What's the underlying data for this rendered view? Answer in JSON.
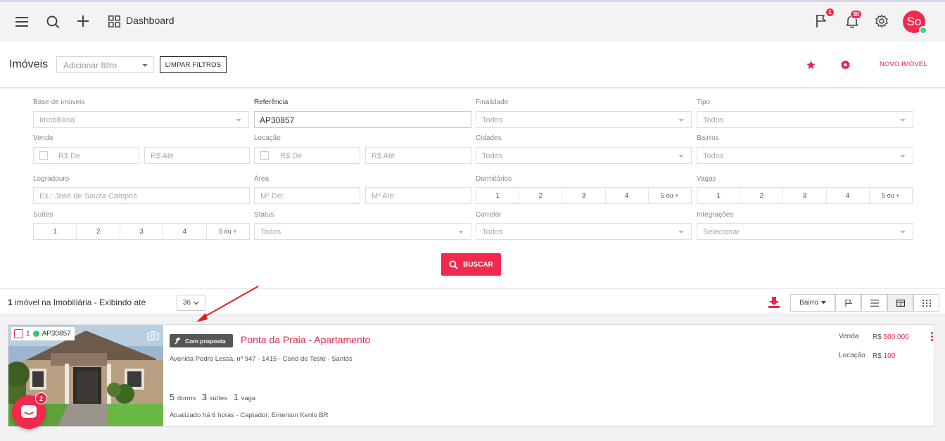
{
  "topbar": {
    "title": "Dashboard",
    "flag_badge": "1",
    "bell_badge": "30",
    "avatar_initials": "So",
    "icons": [
      "menu-icon",
      "search-icon",
      "plus-icon",
      "grid-icon",
      "flag-icon",
      "bell-icon",
      "gear-icon"
    ]
  },
  "header": {
    "title": "Imóveis",
    "filter_placeholder": "Adicionar filtro",
    "clear_label": "LIMPAR FILTROS",
    "new_label": "NOVO IMÓVEL"
  },
  "filters": {
    "base": {
      "label": "Base de imóveis",
      "value": "Imobiliária"
    },
    "referencia": {
      "label": "Referência",
      "value": "AP30857"
    },
    "finalidade": {
      "label": "Finalidade",
      "value": "Todos"
    },
    "tipo": {
      "label": "Tipo",
      "value": "Todos"
    },
    "venda": {
      "label": "Venda",
      "from": "R$ De",
      "to": "R$ Até"
    },
    "locacao": {
      "label": "Locação",
      "from": "R$ De",
      "to": "R$ Até"
    },
    "cidades": {
      "label": "Cidades",
      "value": "Todos"
    },
    "bairros": {
      "label": "Bairros",
      "value": "Todos"
    },
    "logradouro": {
      "label": "Logradouro",
      "placeholder": "Ex.: José de Souza Campos"
    },
    "area": {
      "label": "Área",
      "from": "M² De:",
      "to": "M² Até:"
    },
    "dormitorios": {
      "label": "Dormitórios",
      "options": [
        "1",
        "2",
        "3",
        "4",
        "5 ou +"
      ]
    },
    "vagas": {
      "label": "Vagas",
      "options": [
        "1",
        "2",
        "3",
        "4",
        "5 ou +"
      ]
    },
    "suites": {
      "label": "Suítes",
      "options": [
        "1",
        "2",
        "3",
        "4",
        "5 ou +"
      ]
    },
    "status": {
      "label": "Status",
      "value": "Todos"
    },
    "corretor": {
      "label": "Corretor",
      "value": "Todos"
    },
    "integracoes": {
      "label": "Integrações",
      "value": "Selecionar"
    },
    "search_label": "BUSCAR"
  },
  "results": {
    "count_number": "1",
    "count_text": "imóvel na Imobiliária - Exibindo até",
    "per_page": "36",
    "sort_label": "Bairro"
  },
  "listing": {
    "index": "1",
    "reference": "AP30857",
    "tag": "Com proposta",
    "title": "Ponta da Praia - Apartamento",
    "address": "Avenida Pedro Lessa, nº 947 - 1415 - Cond de Teste - Santos",
    "dorms_n": "5",
    "dorms_l": "dorms",
    "suites_n": "3",
    "suites_l": "suítes",
    "vagas_n": "1",
    "vagas_l": "vaga",
    "updated": "Atualizado há 6 horas - Captador: Emerson Kenlo BR",
    "venda_label": "Venda",
    "venda_currency": "R$",
    "venda_value": "500.000",
    "locacao_label": "Locação",
    "locacao_currency": "R$",
    "locacao_value": "100"
  },
  "chat": {
    "badge": "2"
  },
  "colors": {
    "accent": "#f0294f",
    "online": "#3bd482"
  }
}
